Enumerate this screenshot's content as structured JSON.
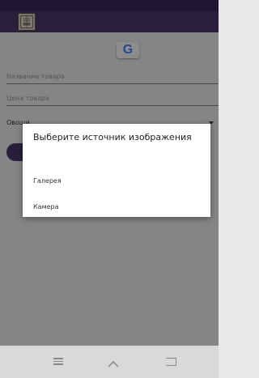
{
  "form": {
    "name_placeholder": "Название товара",
    "price_placeholder": "Цена товара",
    "category_value": "Овощи",
    "google_icon_text": "G"
  },
  "dialog": {
    "title": "Выберите источник изображения",
    "options": [
      "Галерея",
      "Камера"
    ]
  },
  "colors": {
    "appbar": "#4a3a6e",
    "statusbar": "#3a2a5a",
    "google_blue": "#4285f4"
  }
}
